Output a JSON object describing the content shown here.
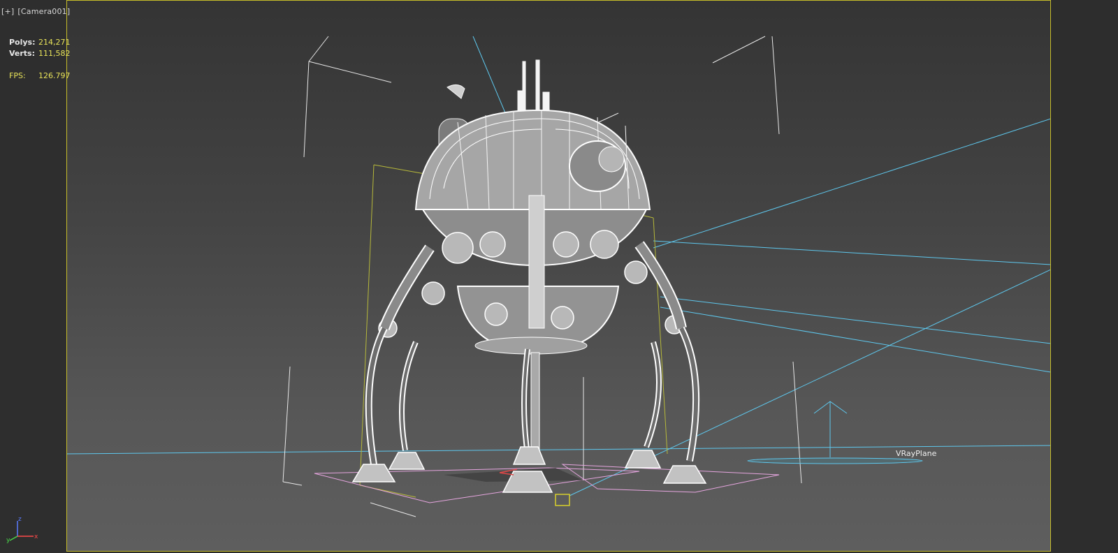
{
  "viewport": {
    "label_plus": "[+]",
    "label_camera": "[Camera001]",
    "active_border_color": "#c7be2a"
  },
  "stats": {
    "polys_label": "Polys:",
    "polys_value": "214,271",
    "verts_label": "Verts:",
    "verts_value": "111,582",
    "fps_label": "FPS:",
    "fps_value": "126.797"
  },
  "scene": {
    "vray_plane_label": "VRayPlane",
    "wire_color": "#ffffff",
    "light_color": "#5ec8ee",
    "bbox_color": "#b7b93a",
    "ground_color": "#e7a6e0"
  },
  "axis_gizmo": {
    "z": "z",
    "y": "y",
    "x": "x"
  }
}
